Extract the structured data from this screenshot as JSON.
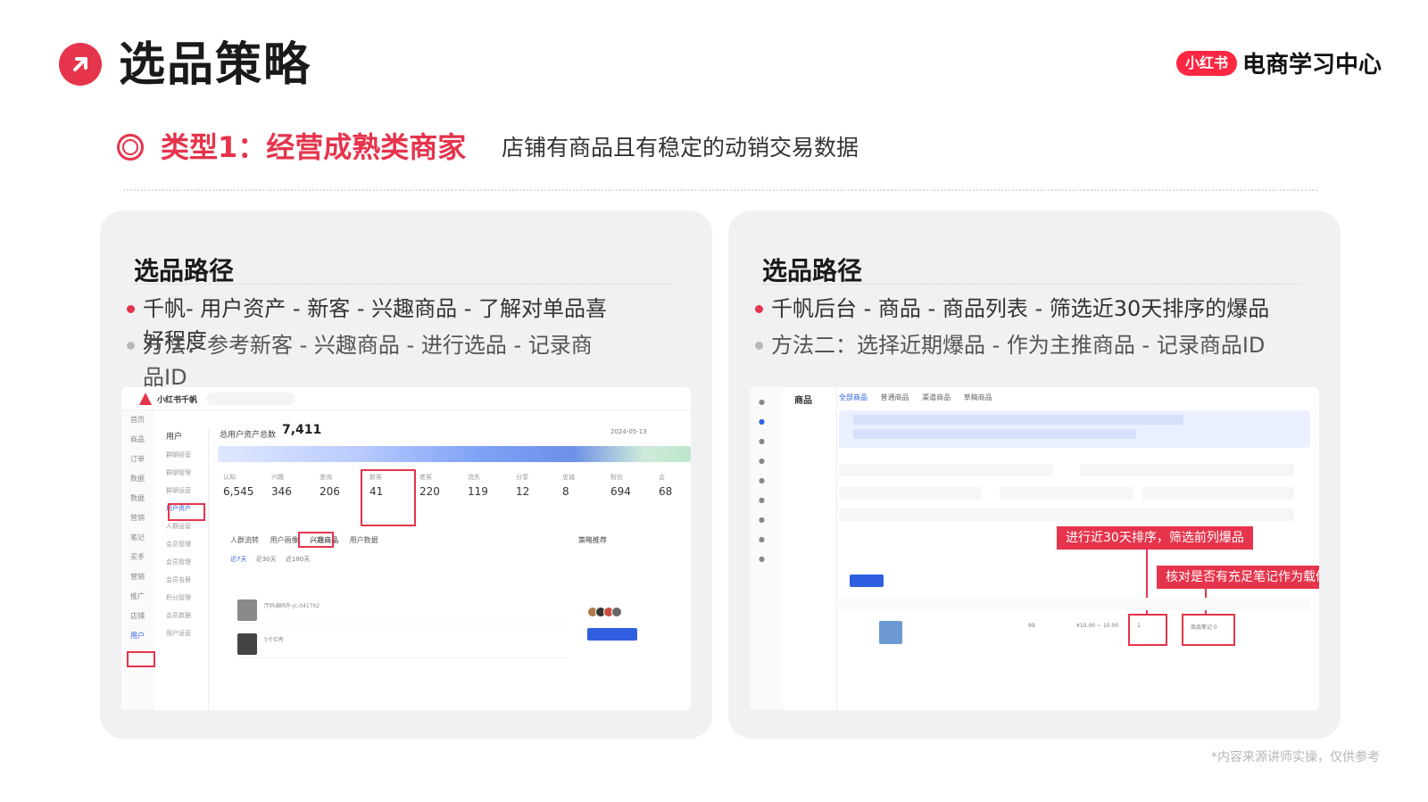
{
  "header": {
    "title": "选品策略",
    "brand_badge": "小红书",
    "brand_name": "电商学习中心"
  },
  "subtitle": {
    "type_label": "类型1：经营成熟类商家",
    "description": "店铺有商品且有稳定的动销交易数据"
  },
  "left_panel": {
    "heading": "选品路径",
    "bullet1_line1": "千帆- 用户资产 -   新客 -   兴趣商品 -   了解对单品喜",
    "bullet1_line2": "好程度",
    "bullet2_line1": "方法：参考新客 -   兴趣商品 -   进行选品 -   记录商",
    "bullet2_line2": "品ID",
    "screenshot": {
      "logo": "小红书千帆",
      "stat_label": "总用户资产总数",
      "stat_value": "7,411",
      "date": "2024-05-13",
      "metrics": [
        {
          "label": "认知",
          "value": "6,545"
        },
        {
          "label": "兴趣",
          "value": "346"
        },
        {
          "label": "查询",
          "value": "206"
        },
        {
          "label": "新客",
          "value": "41"
        },
        {
          "label": "老客",
          "value": "220"
        },
        {
          "label": "流失",
          "value": "119"
        },
        {
          "label": "分享",
          "value": "12"
        },
        {
          "label": "忠诚",
          "value": "8"
        },
        {
          "label": "粉丝",
          "value": "694"
        },
        {
          "label": "会",
          "value": "68"
        }
      ],
      "side_nav": [
        "首页",
        "商品",
        "订单",
        "数据",
        "数据",
        "营销",
        "笔记",
        "买手",
        "营销",
        "推广",
        "店铺",
        "用户"
      ],
      "sub_nav": [
        "用户",
        "群聊经营",
        "群聊管理",
        "群聊运营",
        "用户资产",
        "人群运营",
        "会员管理",
        "会员管理",
        "会员名册",
        "积分管理",
        "会员数据",
        "用户运营"
      ],
      "tabs": [
        "人群流转",
        "用户画像",
        "兴趣商品",
        "用户数据"
      ],
      "chips": [
        "近7天",
        "近30天",
        "近180天"
      ],
      "side_card_title": "策略推荐",
      "row1": "厅码调码外-jc-041702",
      "row2": "5寸位秀"
    }
  },
  "right_panel": {
    "heading": "选品路径",
    "bullet1": "千帆后台 -    商品 - 商品列表 - 筛选近30天排序的爆品",
    "bullet2": "方法二：选择近期爆品 -   作为主推商品 -   记录商品ID",
    "screenshot": {
      "section": "商品",
      "tabs": [
        "全部商品",
        "普通商品",
        "渠道商品",
        "草稿商品"
      ],
      "callout1": "进行近30天排序，筛选前列爆品",
      "callout2": "核对是否有充足笔记作为载体",
      "stock": "99",
      "price": "¥10.00 ~ 10.00",
      "sales": "1",
      "notes": "商品笔记 0"
    }
  },
  "footnote": "*内容来源讲师实操，仅供参考",
  "colors": {
    "accent": "#e5344c",
    "brand": "#ff2742",
    "blue": "#2f5fe0"
  }
}
